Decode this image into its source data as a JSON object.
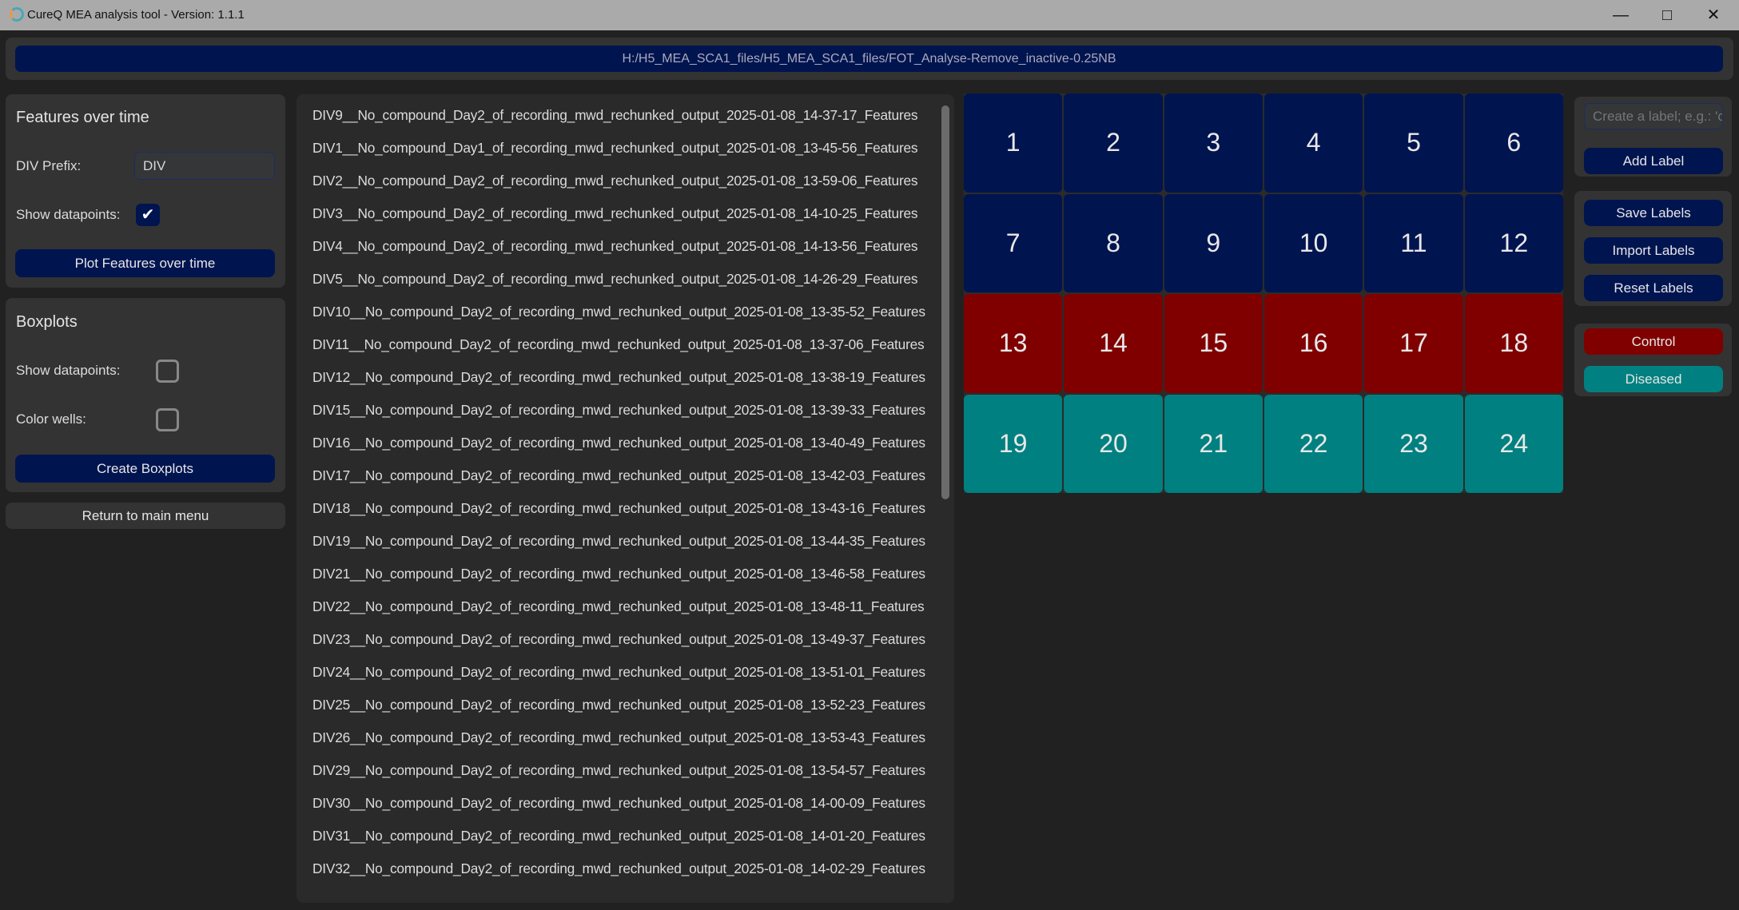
{
  "window": {
    "title": "CureQ MEA analysis tool - Version: 1.1.1",
    "controls": [
      "minimize-icon",
      "maximize-icon",
      "close-icon"
    ]
  },
  "path": "H:/H5_MEA_SCA1_files/H5_MEA_SCA1_files/FOT_Analyse-Remove_inactive-0.25NB",
  "features_over_time": {
    "title": "Features over time",
    "prefix_label": "DIV Prefix:",
    "prefix_value": "DIV",
    "show_datapoints_label": "Show datapoints:",
    "show_datapoints": true,
    "plot_button": "Plot Features over time"
  },
  "boxplots": {
    "title": "Boxplots",
    "show_datapoints_label": "Show datapoints:",
    "show_datapoints": false,
    "color_wells_label": "Color wells:",
    "color_wells": false,
    "create_button": "Create Boxplots"
  },
  "return_button": "Return to main menu",
  "files": [
    "DIV9__No_compound_Day2_of_recording_mwd_rechunked_output_2025-01-08_14-37-17_Features",
    "DIV1__No_compound_Day1_of_recording_mwd_rechunked_output_2025-01-08_13-45-56_Features",
    "DIV2__No_compound_Day2_of_recording_mwd_rechunked_output_2025-01-08_13-59-06_Features",
    "DIV3__No_compound_Day2_of_recording_mwd_rechunked_output_2025-01-08_14-10-25_Features",
    "DIV4__No_compound_Day2_of_recording_mwd_rechunked_output_2025-01-08_14-13-56_Features",
    "DIV5__No_compound_Day2_of_recording_mwd_rechunked_output_2025-01-08_14-26-29_Features",
    "DIV10__No_compound_Day2_of_recording_mwd_rechunked_output_2025-01-08_13-35-52_Features",
    "DIV11__No_compound_Day2_of_recording_mwd_rechunked_output_2025-01-08_13-37-06_Features",
    "DIV12__No_compound_Day2_of_recording_mwd_rechunked_output_2025-01-08_13-38-19_Features",
    "DIV15__No_compound_Day2_of_recording_mwd_rechunked_output_2025-01-08_13-39-33_Features",
    "DIV16__No_compound_Day2_of_recording_mwd_rechunked_output_2025-01-08_13-40-49_Features",
    "DIV17__No_compound_Day2_of_recording_mwd_rechunked_output_2025-01-08_13-42-03_Features",
    "DIV18__No_compound_Day2_of_recording_mwd_rechunked_output_2025-01-08_13-43-16_Features",
    "DIV19__No_compound_Day2_of_recording_mwd_rechunked_output_2025-01-08_13-44-35_Features",
    "DIV21__No_compound_Day2_of_recording_mwd_rechunked_output_2025-01-08_13-46-58_Features",
    "DIV22__No_compound_Day2_of_recording_mwd_rechunked_output_2025-01-08_13-48-11_Features",
    "DIV23__No_compound_Day2_of_recording_mwd_rechunked_output_2025-01-08_13-49-37_Features",
    "DIV24__No_compound_Day2_of_recording_mwd_rechunked_output_2025-01-08_13-51-01_Features",
    "DIV25__No_compound_Day2_of_recording_mwd_rechunked_output_2025-01-08_13-52-23_Features",
    "DIV26__No_compound_Day2_of_recording_mwd_rechunked_output_2025-01-08_13-53-43_Features",
    "DIV29__No_compound_Day2_of_recording_mwd_rechunked_output_2025-01-08_13-54-57_Features",
    "DIV30__No_compound_Day2_of_recording_mwd_rechunked_output_2025-01-08_14-00-09_Features",
    "DIV31__No_compound_Day2_of_recording_mwd_rechunked_output_2025-01-08_14-01-20_Features",
    "DIV32__No_compound_Day2_of_recording_mwd_rechunked_output_2025-01-08_14-02-29_Features"
  ],
  "wells": [
    {
      "n": "1",
      "label": "none"
    },
    {
      "n": "2",
      "label": "none"
    },
    {
      "n": "3",
      "label": "none"
    },
    {
      "n": "4",
      "label": "none"
    },
    {
      "n": "5",
      "label": "none"
    },
    {
      "n": "6",
      "label": "none"
    },
    {
      "n": "7",
      "label": "none"
    },
    {
      "n": "8",
      "label": "none"
    },
    {
      "n": "9",
      "label": "none"
    },
    {
      "n": "10",
      "label": "none"
    },
    {
      "n": "11",
      "label": "none"
    },
    {
      "n": "12",
      "label": "none"
    },
    {
      "n": "13",
      "label": "Control"
    },
    {
      "n": "14",
      "label": "Control"
    },
    {
      "n": "15",
      "label": "Control"
    },
    {
      "n": "16",
      "label": "Control"
    },
    {
      "n": "17",
      "label": "Control"
    },
    {
      "n": "18",
      "label": "Control"
    },
    {
      "n": "19",
      "label": "Diseased"
    },
    {
      "n": "20",
      "label": "Diseased"
    },
    {
      "n": "21",
      "label": "Diseased"
    },
    {
      "n": "22",
      "label": "Diseased"
    },
    {
      "n": "23",
      "label": "Diseased"
    },
    {
      "n": "24",
      "label": "Diseased"
    }
  ],
  "labels_panel": {
    "input_placeholder": "Create a label; e.g.: 'control'",
    "add": "Add Label",
    "save": "Save Labels",
    "import": "Import Labels",
    "reset": "Reset Labels",
    "labels": [
      {
        "name": "Control",
        "color": "#800000"
      },
      {
        "name": "Diseased",
        "color": "#008080"
      }
    ]
  },
  "colors": {
    "unassigned": "#001450",
    "accent": "#001450"
  }
}
